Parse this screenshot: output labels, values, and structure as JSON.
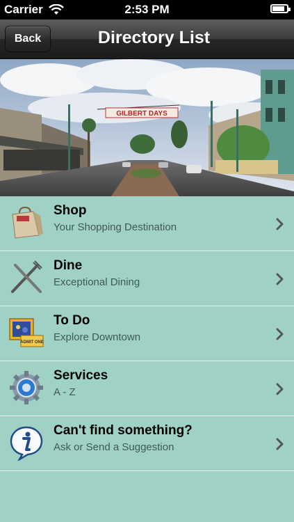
{
  "status_bar": {
    "carrier": "Carrier",
    "time": "2:53 PM"
  },
  "nav": {
    "back_label": "Back",
    "title": "Directory List"
  },
  "hero": {
    "banner_text": "GILBERT DAYS",
    "description": "street photo"
  },
  "list": {
    "items": [
      {
        "title": "Shop",
        "subtitle": "Your Shopping Destination",
        "icon": "shopping-bag-icon"
      },
      {
        "title": "Dine",
        "subtitle": "Exceptional Dining",
        "icon": "fork-knife-icon"
      },
      {
        "title": "To Do",
        "subtitle": "Explore Downtown",
        "icon": "tickets-icon"
      },
      {
        "title": "Services",
        "subtitle": "A - Z",
        "icon": "gear-icon"
      },
      {
        "title": "Can't find something?",
        "subtitle": "Ask or Send a Suggestion",
        "icon": "info-icon"
      }
    ]
  },
  "colors": {
    "list_background": "#9fd2c4",
    "navbar": "#2a2a2a"
  }
}
